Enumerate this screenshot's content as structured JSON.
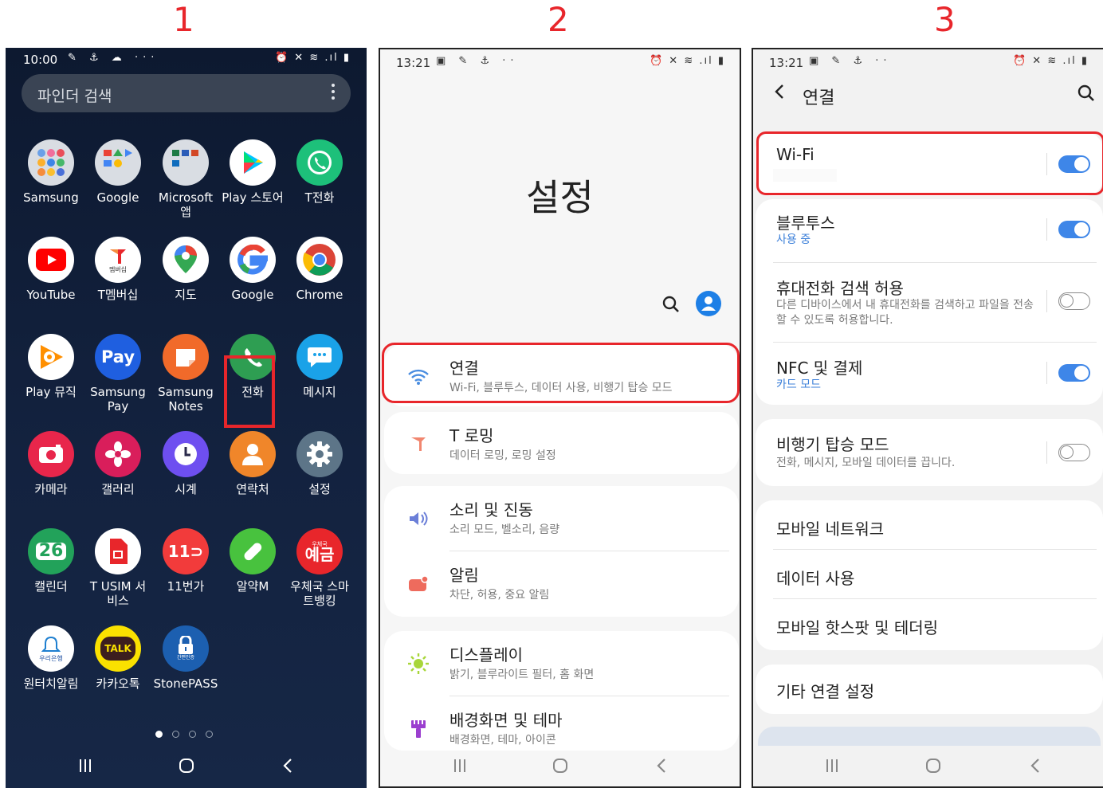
{
  "steps": [
    "1",
    "2",
    "3"
  ],
  "panel1": {
    "status": {
      "time": "10:00",
      "icons": "✎ ⚓ ☁ ···",
      "right": "⏰ ✕ ≋ .ıl ▮"
    },
    "search": {
      "placeholder": "파인더 검색"
    },
    "apps": [
      {
        "label": "Samsung",
        "icon": "samsung-folder-icon"
      },
      {
        "label": "Google",
        "icon": "google-folder-icon"
      },
      {
        "label": "Microsoft 앱",
        "icon": "microsoft-folder-icon"
      },
      {
        "label": "Play 스토어",
        "icon": "play-store-icon"
      },
      {
        "label": "T전화",
        "icon": "t-phone-icon"
      },
      {
        "label": "YouTube",
        "icon": "youtube-icon"
      },
      {
        "label": "T멤버십",
        "icon": "t-membership-icon",
        "badge": "멤버십"
      },
      {
        "label": "지도",
        "icon": "maps-icon"
      },
      {
        "label": "Google",
        "icon": "google-icon"
      },
      {
        "label": "Chrome",
        "icon": "chrome-icon"
      },
      {
        "label": "Play 뮤직",
        "icon": "play-music-icon"
      },
      {
        "label": "Samsung Pay",
        "icon": "samsung-pay-icon",
        "glyph": "Pay"
      },
      {
        "label": "Samsung Notes",
        "icon": "samsung-notes-icon"
      },
      {
        "label": "전화",
        "icon": "phone-icon"
      },
      {
        "label": "메시지",
        "icon": "messages-icon"
      },
      {
        "label": "카메라",
        "icon": "camera-icon"
      },
      {
        "label": "갤러리",
        "icon": "gallery-icon"
      },
      {
        "label": "시계",
        "icon": "clock-icon"
      },
      {
        "label": "연락처",
        "icon": "contacts-icon"
      },
      {
        "label": "설정",
        "icon": "settings-gear-icon"
      },
      {
        "label": "캘린더",
        "icon": "calendar-icon",
        "glyph": "26"
      },
      {
        "label": "T USIM 서비스",
        "icon": "t-usim-icon"
      },
      {
        "label": "11번가",
        "icon": "11st-icon",
        "glyph": "11⊃"
      },
      {
        "label": "알약M",
        "icon": "alyac-icon"
      },
      {
        "label": "우체국 스마트뱅킹",
        "icon": "post-bank-icon",
        "glyph": "예금",
        "badge": "우체국"
      },
      {
        "label": "원터치알림",
        "icon": "one-touch-alarm-icon",
        "badge": "우리은행"
      },
      {
        "label": "카카오톡",
        "icon": "kakaotalk-icon",
        "glyph": "TALK"
      },
      {
        "label": "StonePASS",
        "icon": "stonepass-icon",
        "badge": "간편인증"
      }
    ],
    "colors": {
      "highlight": "#e8262b",
      "background": "#12203c"
    }
  },
  "panel2": {
    "status": {
      "time": "13:21",
      "icons": "▣ ✎ ⚓ ··",
      "right": "⏰ ✕ ≋ .ıl ▮"
    },
    "title": "설정",
    "items": [
      {
        "title": "연결",
        "sub": "Wi-Fi, 블루투스, 데이터 사용, 비행기 탑승 모드",
        "icon": "wifi-icon"
      },
      {
        "title": "T 로밍",
        "sub": "데이터 로밍, 로밍 설정",
        "icon": "t-roaming-icon"
      },
      {
        "title": "소리 및 진동",
        "sub": "소리 모드, 벨소리, 음량",
        "icon": "sound-icon"
      },
      {
        "title": "알림",
        "sub": "차단, 허용, 중요 알림",
        "icon": "notification-icon"
      },
      {
        "title": "디스플레이",
        "sub": "밝기, 블루라이트 필터, 홈 화면",
        "icon": "display-icon"
      },
      {
        "title": "배경화면 및 테마",
        "sub": "배경화면, 테마, 아이콘",
        "icon": "wallpaper-icon"
      }
    ]
  },
  "panel3": {
    "status": {
      "time": "13:21",
      "icons": "▣ ✎ ⚓ ··",
      "right": "⏰ ✕ ≋ .ıl ▮"
    },
    "header": {
      "back": "<",
      "title": "연결"
    },
    "items": [
      {
        "title": "Wi-Fi",
        "sub": "",
        "toggle": "on"
      },
      {
        "title": "블루투스",
        "sub": "사용 중",
        "toggle": "on"
      },
      {
        "title": "휴대전화 검색 허용",
        "sub": "다른 디바이스에서 내 휴대전화를 검색하고 파일을 전송할 수 있도록 허용합니다.",
        "toggle": "off"
      },
      {
        "title": "NFC 및 결제",
        "sub": "카드 모드",
        "toggle": "on"
      },
      {
        "title": "비행기 탑승 모드",
        "sub": "전화, 메시지, 모바일 데이터를 끕니다.",
        "toggle": "off"
      },
      {
        "title": "모바일 네트워크"
      },
      {
        "title": "데이터 사용"
      },
      {
        "title": "모바일 핫스팟 및 테더링"
      },
      {
        "title": "기타 연결 설정"
      }
    ],
    "colors": {
      "toggle_on": "#3e86e8",
      "sub_blue": "#3b7fd9"
    }
  }
}
